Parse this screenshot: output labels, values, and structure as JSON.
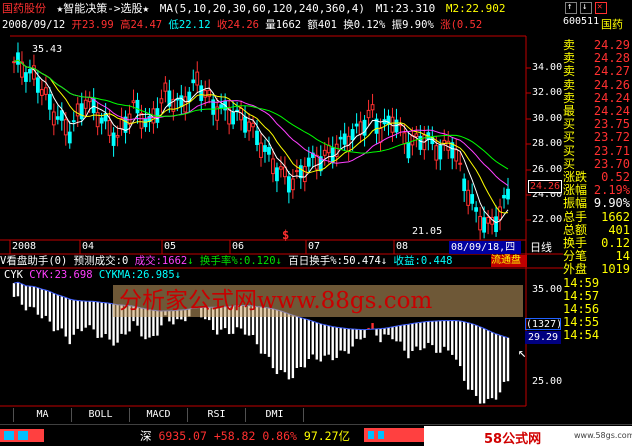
{
  "header": {
    "stock_name": "国药股份",
    "strategy": "★智能决策->选股★",
    "ma_label": "MA(5,10,20,30,60,120,240,360,4)",
    "m1": "M1:23.310",
    "m2": "M2:22.902"
  },
  "quote_line": {
    "date": "2008/09/12",
    "open": "开23.99",
    "high": "高24.47",
    "low": "低22.12",
    "close": "收24.26",
    "volume": "量1662",
    "amount": "额401",
    "turnover": "换0.12%",
    "amplitude": "振9.90%",
    "change": "涨(0.52"
  },
  "price_axis": [
    "34.00",
    "32.00",
    "30.00",
    "28.00",
    "26.00",
    "24.00",
    "22.00"
  ],
  "current_price": "24.26",
  "high_label": "35.43",
  "low_label": "21.05",
  "time_axis": [
    "2008",
    "04",
    "05",
    "06",
    "07",
    "08"
  ],
  "cursor_date": "08/09/18,四",
  "period_label": "日线",
  "indicator1": {
    "title": "V看盘助手(0)",
    "forecast": "预测成交:0",
    "chengjiao": "成交:1662",
    "huanshou": "换手率%:0.120",
    "bairi": "百日换手%:50.474",
    "shouyi": "收益:0.448",
    "liutong": "流通盘"
  },
  "indicator2": {
    "name": "CYK",
    "cyk": "CYK:23.698",
    "cykma": "CYKMA:26.985",
    "axis": [
      "35.00",
      "25.00"
    ],
    "mark": "(1327)",
    "value": "29.29"
  },
  "watermark": "分析家公式网www.88gs.com",
  "tabs": [
    "MA",
    "BOLL",
    "MACD",
    "RSI",
    "DMI"
  ],
  "status": {
    "index": "深",
    "value": "6935.07",
    "change": "+58.82",
    "pct": "0.86%",
    "amount": "97.27亿"
  },
  "brand": "58公式网",
  "brand_url": "www.58gs.com",
  "side": {
    "code": "600511",
    "name": "国药",
    "rows": [
      {
        "label": "卖",
        "value": "24.29"
      },
      {
        "label": "卖",
        "value": "24.28"
      },
      {
        "label": "卖",
        "value": "24.27"
      },
      {
        "label": "卖",
        "value": "24.26"
      },
      {
        "label": "卖",
        "value": "24.24"
      },
      {
        "label": "最",
        "value": "24.24"
      },
      {
        "label": "买",
        "value": "23.75"
      },
      {
        "label": "买",
        "value": "23.72"
      },
      {
        "label": "买",
        "value": "23.71"
      },
      {
        "label": "买",
        "value": "23.70"
      },
      {
        "label": "涨跌",
        "value": "0.52"
      },
      {
        "label": "涨幅",
        "value": "2.19%"
      },
      {
        "label": "振幅",
        "value": "9.90%"
      },
      {
        "label": "总手",
        "value": "1662"
      },
      {
        "label": "总额",
        "value": "401"
      },
      {
        "label": "换手",
        "value": "0.12"
      },
      {
        "label": "分笔",
        "value": "14"
      },
      {
        "label": "外盘",
        "value": "1019"
      },
      {
        "label": "14:59",
        "value": ""
      },
      {
        "label": "14:57",
        "value": ""
      },
      {
        "label": "14:56",
        "value": ""
      },
      {
        "label": "14:55",
        "value": ""
      },
      {
        "label": "14:54",
        "value": ""
      }
    ]
  },
  "colors": {
    "up": "#ff3030",
    "down": "#00ffff",
    "ma5": "#ffffff",
    "ma10": "#ffff00",
    "ma20": "#ff40ff",
    "ma30": "#00ff00",
    "border": "#c00000"
  }
}
